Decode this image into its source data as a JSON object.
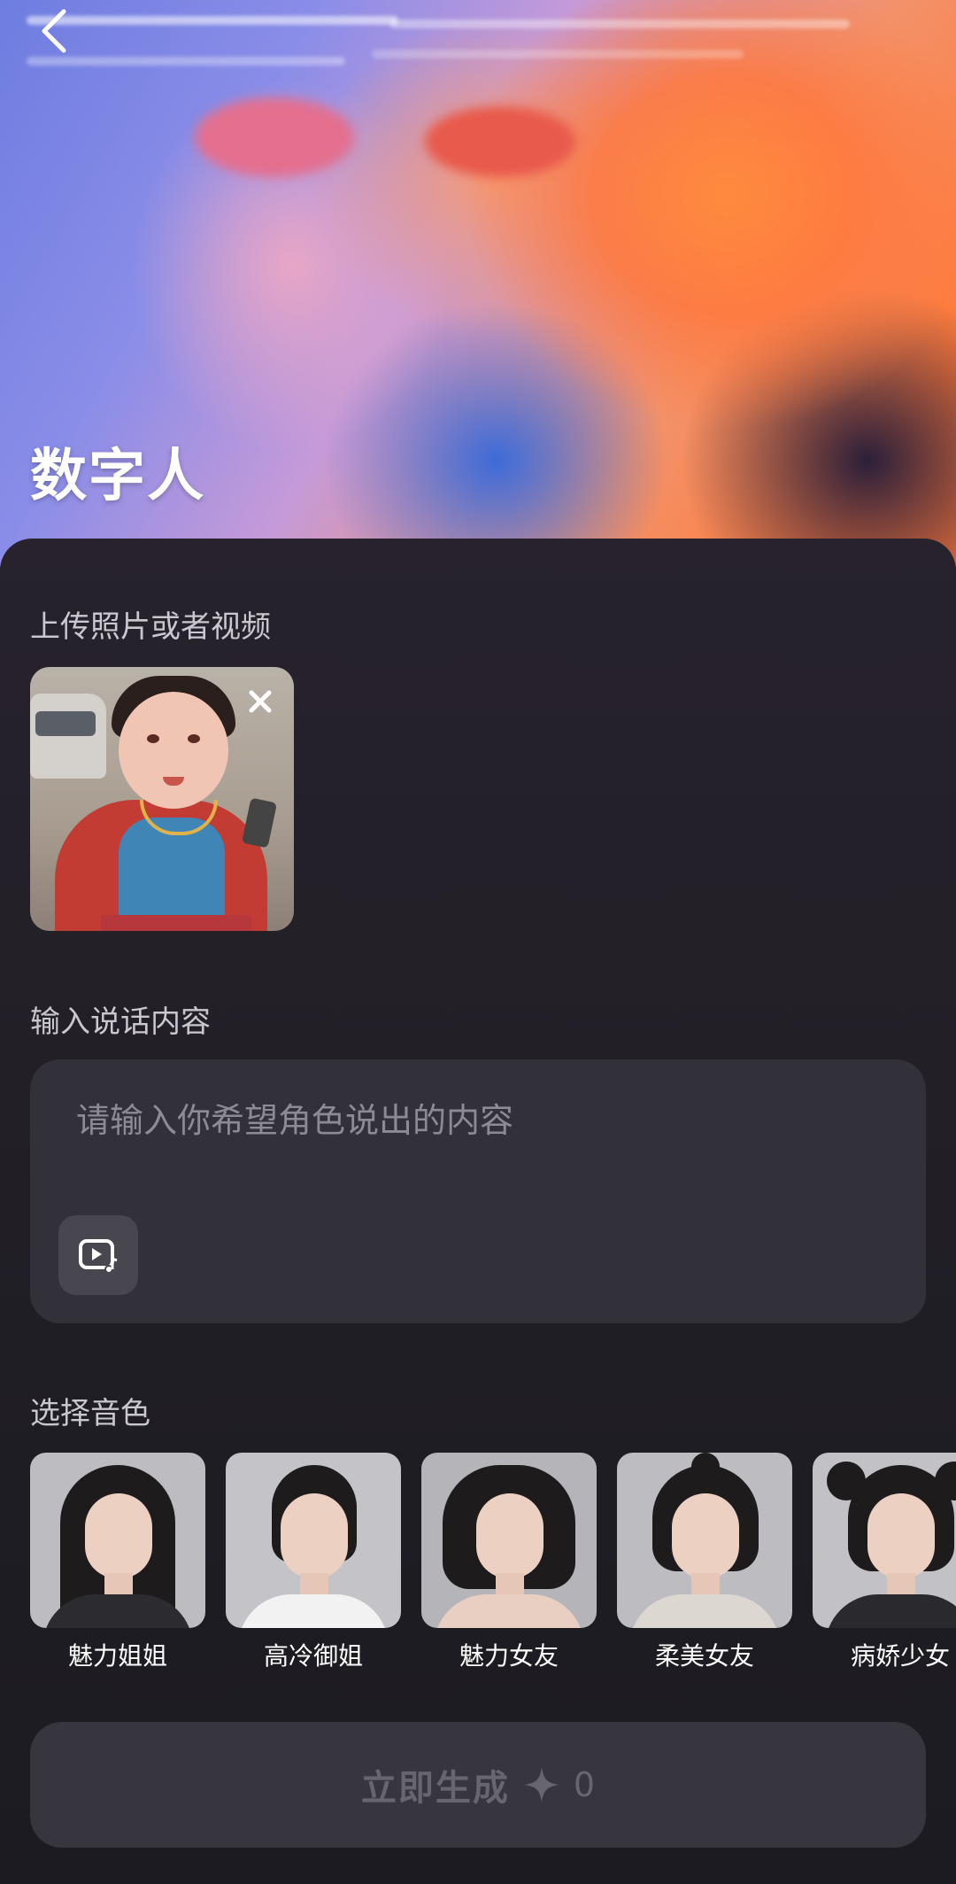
{
  "header": {
    "title": "数字人",
    "back_icon": "chevron-left-icon"
  },
  "upload": {
    "label": "上传照片或者视频",
    "close_icon": "close-icon"
  },
  "speech": {
    "label": "输入说话内容",
    "placeholder": "请输入你希望角色说出的内容",
    "value": "",
    "audio_icon": "video-music-icon"
  },
  "voice": {
    "label": "选择音色",
    "options": [
      {
        "name": "魅力姐姐"
      },
      {
        "name": "高冷御姐"
      },
      {
        "name": "魅力女友"
      },
      {
        "name": "柔美女友"
      },
      {
        "name": "病娇少女"
      }
    ]
  },
  "generate": {
    "label": "立即生成",
    "cost": "0",
    "cost_icon": "sparkle-icon"
  },
  "colors": {
    "background": "#1b1a20",
    "panel": "#27222c",
    "input_bg": "#323038",
    "button_bg": "#37353d",
    "muted_text": "#67656d"
  }
}
